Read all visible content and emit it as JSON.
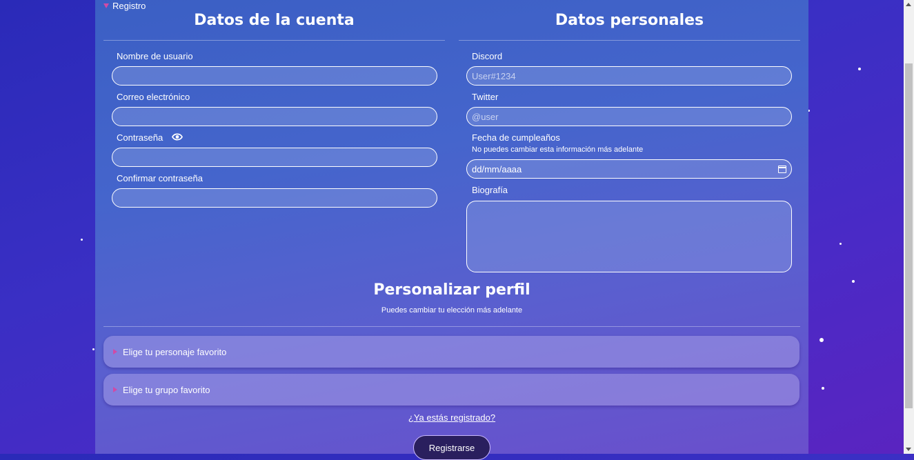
{
  "registro_summary": "Registro",
  "account": {
    "title": "Datos de la cuenta",
    "username_label": "Nombre de usuario",
    "email_label": "Correo electrónico",
    "password_label": "Contraseña",
    "confirm_password_label": "Confirmar contraseña"
  },
  "personal": {
    "title": "Datos personales",
    "discord_label": "Discord",
    "discord_placeholder": "User#1234",
    "twitter_label": "Twitter",
    "twitter_placeholder": "@user",
    "birthday_label": "Fecha de cumpleaños",
    "birthday_hint": "No puedes cambiar esta información más adelante",
    "birthday_placeholder": "dd/mm/aaaa",
    "bio_label": "Biografía"
  },
  "profile": {
    "title": "Personalizar perfil",
    "subtitle": "Puedes cambiar tu elección más adelante",
    "favorite_character": "Elige tu personaje favorito",
    "favorite_group": "Elige tu grupo favorito"
  },
  "footer": {
    "login_link": "¿Ya estás registrado?",
    "submit": "Registrarse"
  },
  "colors": {
    "accent_triangle": "#d04aa6",
    "button_bg": "#2a1f5e"
  },
  "icons": [
    "caret-down-icon",
    "eye-icon",
    "calendar-icon",
    "caret-right-icon"
  ]
}
